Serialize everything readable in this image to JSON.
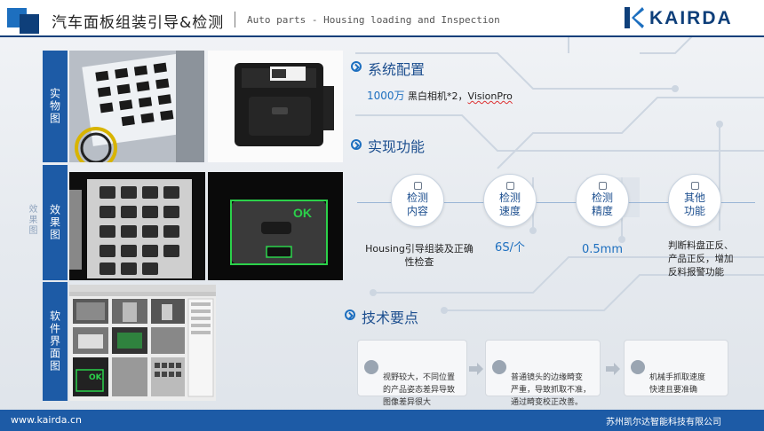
{
  "header": {
    "title": "汽车面板组装引导&检测",
    "subtitle": "Auto parts - Housing loading and Inspection",
    "logo_text": "KAIRDA"
  },
  "left": {
    "label_real": "实物图",
    "label_effect": "效果图",
    "label_software": "软件界面图",
    "ghost_label": "效果图",
    "ok_text": "OK",
    "ok_text_small": "OK"
  },
  "system": {
    "heading": "系统配置",
    "highlight": "1000万",
    "desc": " 黑白相机*2，",
    "vision": "VisionPro"
  },
  "functions": {
    "heading": "实现功能",
    "items": [
      {
        "label": "检测\n内容",
        "value": "Housing引导组装及正确\n性检查"
      },
      {
        "label": "检测\n速度",
        "value": "6S/个"
      },
      {
        "label": "检测\n精度",
        "value": "0.5mm"
      },
      {
        "label": "其他\n功能",
        "value": "判断料盘正反、\n产品正反，增加\n反料报警功能"
      }
    ]
  },
  "tech": {
    "heading": "技术要点",
    "points": [
      "视野较大，不同位置\n的产品姿态差异导致\n图像差异很大",
      "普通镜头的边缘畸变\n严重，导致抓取不准，\n通过畸变校正改善。",
      "机械手抓取速度\n快速且要准确"
    ]
  },
  "footer": {
    "url": "www.kairda.cn",
    "company": "苏州凯尔达智能科技有限公司"
  },
  "colors": {
    "primary": "#1d5ba6",
    "dark": "#0e3f7a",
    "accent": "#1d6fbf",
    "ok_green": "#2bd14a"
  }
}
